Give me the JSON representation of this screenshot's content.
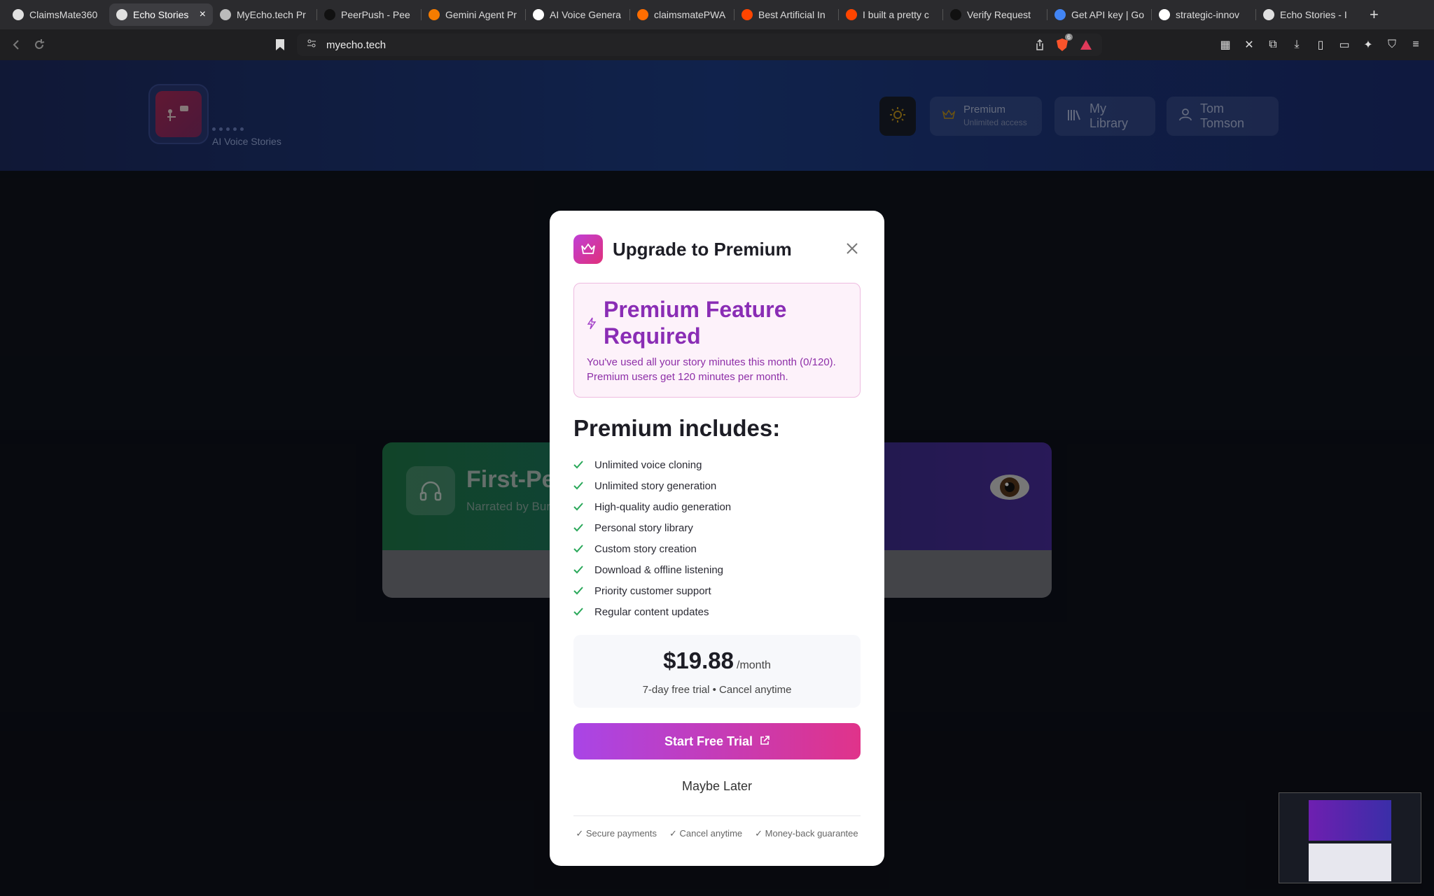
{
  "browser": {
    "tabs": [
      {
        "label": "ClaimsMate360",
        "color": "#e0e0e0"
      },
      {
        "label": "Echo Stories",
        "color": "#e0e0e0",
        "active": true
      },
      {
        "label": "MyEcho.tech Pr",
        "color": "#bbbbbb"
      },
      {
        "label": "PeerPush - Pee",
        "color": "#111111"
      },
      {
        "label": "Gemini Agent Pr",
        "color": "#f57c00"
      },
      {
        "label": "AI Voice Genera",
        "color": "#ffffff"
      },
      {
        "label": "claimsmatePWA",
        "color": "#ff6d00"
      },
      {
        "label": "Best Artificial In",
        "color": "#ff4500"
      },
      {
        "label": "I built a pretty c",
        "color": "#ff4500"
      },
      {
        "label": "Verify Request",
        "color": "#111111"
      },
      {
        "label": "Get API key | Go",
        "color": "#4285f4"
      },
      {
        "label": "strategic-innov",
        "color": "#ffffff"
      },
      {
        "label": "Echo Stories - I",
        "color": "#e0e0e0"
      }
    ],
    "new_tab": "+",
    "url": "myecho.tech",
    "shield_count": "6"
  },
  "header": {
    "brand_subtitle": "AI Voice Stories",
    "premium_title": "Premium",
    "premium_sub": "Unlimited access",
    "library_label": "My Library",
    "user_name": "Tom Tomson"
  },
  "story": {
    "title": "First-Pe",
    "narrator": "Narrated by Bur"
  },
  "modal": {
    "title": "Upgrade to Premium",
    "alert_title": "Premium Feature Required",
    "alert_message": "You've used all your story minutes this month (0/120). Premium users get 120 minutes per month.",
    "includes_title": "Premium includes:",
    "features": [
      "Unlimited voice cloning",
      "Unlimited story generation",
      "High-quality audio generation",
      "Personal story library",
      "Custom story creation",
      "Download & offline listening",
      "Priority customer support",
      "Regular content updates"
    ],
    "price": "$19.88",
    "per": "/month",
    "price_note": "7-day free trial • Cancel anytime",
    "cta": "Start Free Trial",
    "later": "Maybe Later",
    "guarantees": [
      "✓ Secure payments",
      "✓ Cancel anytime",
      "✓ Money-back guarantee"
    ]
  },
  "colors": {
    "accent_gradient_start": "#a945e6",
    "accent_gradient_end": "#e0338a",
    "check": "#2aa85a",
    "alert_text": "#8a2db5"
  }
}
